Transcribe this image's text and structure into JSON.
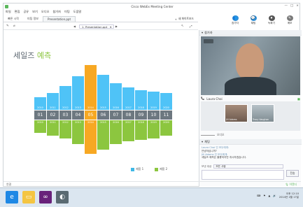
{
  "window": {
    "title": "Cisco WebEx Meeting Center",
    "controls": [
      "—",
      "□",
      "×"
    ]
  },
  "menu": [
    "파일",
    "편집",
    "공유",
    "보기",
    "오디오",
    "참가자",
    "미팅",
    "도움말"
  ],
  "tabs": [
    "빠른 시작",
    "미팅 정보",
    "Presentation.ppt"
  ],
  "share_label": "새 화이트보드",
  "toolbar_big": [
    {
      "label": "참가자",
      "color": "#2f8fd8",
      "glyph": "👥"
    },
    {
      "label": "채팅",
      "color": "#2f8fd8",
      "glyph": "💬"
    },
    {
      "label": "녹화기",
      "color": "#555555",
      "glyph": "⏺"
    },
    {
      "label": "메모",
      "color": "#7a7a7a",
      "glyph": "✎"
    }
  ],
  "docbar": {
    "page_select": "1. Presentation.ppt",
    "prev": "◀",
    "next": "▶"
  },
  "slide": {
    "title_main": "세일즈",
    "title_accent": "예측",
    "years": [
      "2010",
      "2011",
      "2012",
      "2013",
      "2014",
      "2015",
      "2016",
      "2017",
      "2018",
      "2019",
      "2020"
    ],
    "months": [
      "01",
      "02",
      "03",
      "04",
      "05",
      "06",
      "07",
      "08",
      "09",
      "10",
      "11"
    ],
    "years_lower": [
      "2010",
      "2011",
      "2012",
      "2013",
      "2014",
      "2015",
      "2016",
      "2017",
      "2018",
      "2019",
      "2020"
    ],
    "legend": [
      {
        "label": "제품 1",
        "color": "#3fb8e6"
      },
      {
        "label": "제품 2",
        "color": "#8cc63f"
      }
    ]
  },
  "colors": {
    "blue": "#4fc3f7",
    "green": "#8cc63f",
    "orange": "#f7a823",
    "gray": "#6d7880"
  },
  "right_pane": {
    "header": "참가자",
    "speaker": "Laura Choi",
    "thumb_names": [
      "Jill Adams",
      "Tracy Vaughan"
    ],
    "audio_label": "오디오",
    "chat_header": "채팅",
    "chat_lines": [
      {
        "user": "Laura Choi 인 모두에게:",
        "text": "안녕하십니까?"
      },
      {
        "user": "Jill Adams 인 모두에게:",
        "text": "세일즈 예측은 훌륭하지만 개시하겠습니다."
      }
    ],
    "send_to_label": "보낸 대상",
    "send_to_value": "모든 사람",
    "send_button": "전송"
  },
  "status": {
    "left": "연결",
    "right": "어텐더"
  },
  "taskbar": {
    "apps": [
      {
        "name": "ie",
        "color": "#1e88e5",
        "glyph": "e"
      },
      {
        "name": "explorer",
        "color": "#f4c542",
        "glyph": "▭"
      },
      {
        "name": "visual-studio",
        "color": "#68217a",
        "glyph": "∞"
      },
      {
        "name": "webex",
        "color": "#5a6a72",
        "glyph": "◐"
      }
    ],
    "time": "오후 12:10",
    "date": "2014년 1월 17일"
  }
}
